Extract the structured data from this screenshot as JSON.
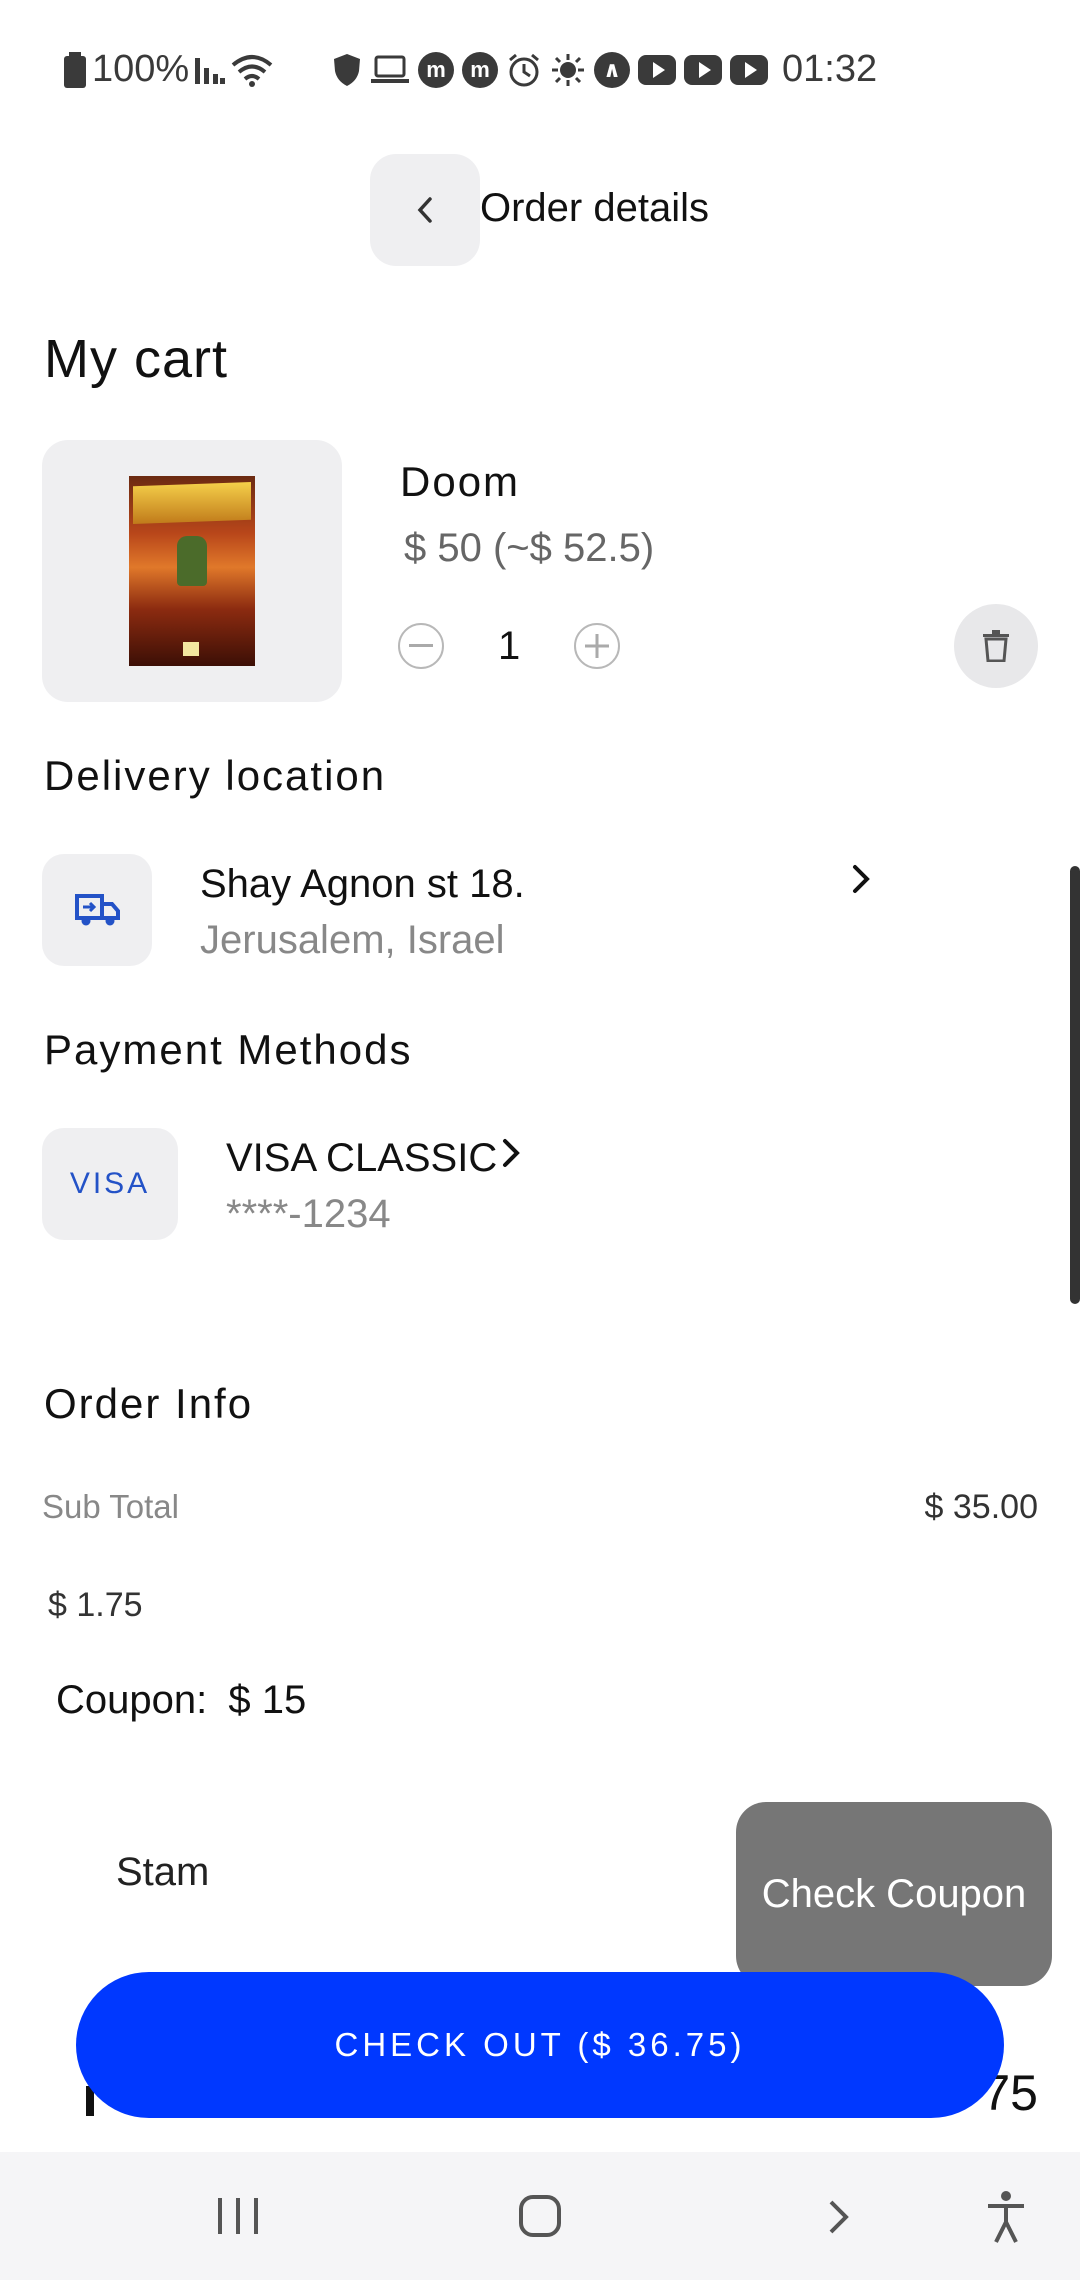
{
  "status_bar": {
    "battery": "100%",
    "time": "01:32"
  },
  "header": {
    "title": "Order details"
  },
  "cart": {
    "title": "My cart",
    "items": [
      {
        "name": "Doom",
        "price": "$ 50 (~$ 52.5)",
        "quantity": "1"
      }
    ]
  },
  "delivery": {
    "title": "Delivery location",
    "address_line1": "Shay Agnon st 18.",
    "address_line2": "Jerusalem, Israel"
  },
  "payment": {
    "title": "Payment Methods",
    "card_brand": "VISA",
    "card_name": "VISA CLASSIC",
    "card_number": "****-1234"
  },
  "order_info": {
    "title": "Order Info",
    "subtotal_label": "Sub Total",
    "subtotal_value": "$ 35.00",
    "fee_value": "$ 1.75",
    "coupon_label": "Coupon:",
    "coupon_value": "$ 15"
  },
  "coupon": {
    "input_value": "Stam",
    "check_button": "Check Coupon"
  },
  "total_partial": "75",
  "checkout": {
    "label": "CHECK OUT ($ 36.75)"
  },
  "colors": {
    "accent": "#0038ff",
    "card_blue": "#2352c7",
    "chip_bg": "#efeff1",
    "check_coupon_bg": "#767676"
  }
}
